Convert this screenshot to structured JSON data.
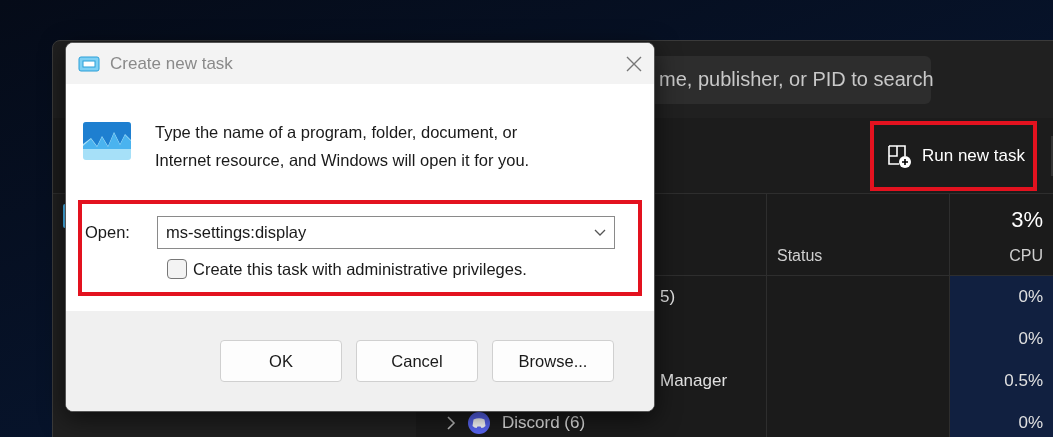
{
  "task_manager": {
    "search": {
      "placeholder": "me, publisher, or PID to search"
    },
    "run_new_task": {
      "label": "Run new task",
      "highlighted": true
    },
    "columns": [
      {
        "label": "Status"
      },
      {
        "label": "CPU",
        "total": "3%"
      }
    ],
    "rows": [
      {
        "kind": "plain",
        "name": "5)",
        "cpu": "0%"
      },
      {
        "kind": "plain",
        "cpu": "0%"
      },
      {
        "kind": "plain",
        "name": "Manager",
        "cpu": "0.5%"
      },
      {
        "kind": "group",
        "name": "Discord (6)",
        "cpu": "0%"
      }
    ]
  },
  "dialog": {
    "title": "Create new task",
    "message": "Type the name of a program, folder, document, or Internet resource, and Windows will open it for you.",
    "open_label": "Open:",
    "open_value": "ms-settings:display",
    "highlighted": true,
    "admin_checkbox": {
      "label": "Create this task with administrative privileges.",
      "checked": false
    },
    "buttons": [
      "OK",
      "Cancel",
      "Browse..."
    ]
  }
}
